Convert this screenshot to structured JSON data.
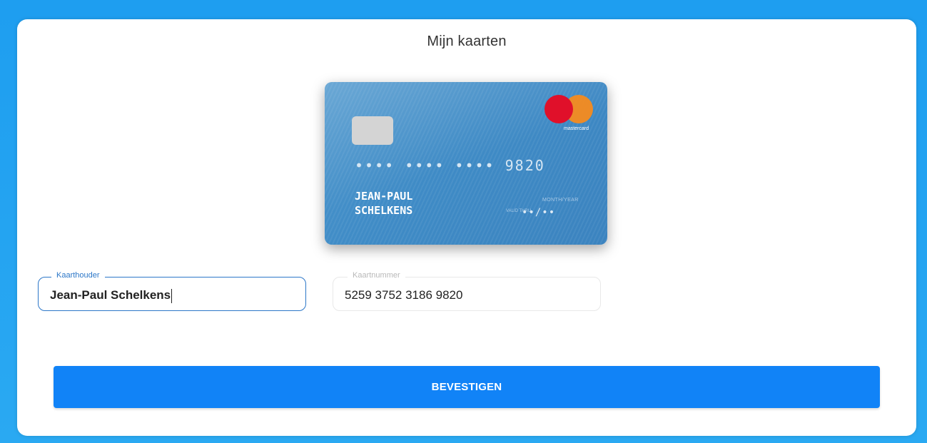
{
  "page": {
    "title": "Mijn kaarten"
  },
  "card": {
    "brand": "mastercard",
    "brand_icon": "mastercard-logo-icon",
    "number_masked": "•••• •••• •••• 9820",
    "holder_line1": "JEAN-PAUL",
    "holder_line2": "SCHELKENS",
    "expiry_label": "MONTH/YEAR",
    "expiry_small": "VALID THRU",
    "expiry_value": "••/••",
    "colors": {
      "card_bg": "#4a95cc",
      "mc_red": "#e0102a",
      "mc_orange": "#f58b1f"
    }
  },
  "form": {
    "holder": {
      "label": "Kaarthouder",
      "value": "Jean-Paul Schelkens"
    },
    "number": {
      "label": "Kaartnummer",
      "value": "5259 3752 3186 9820"
    }
  },
  "actions": {
    "confirm_label": "BEVESTIGEN",
    "accent": "#1183f7"
  }
}
